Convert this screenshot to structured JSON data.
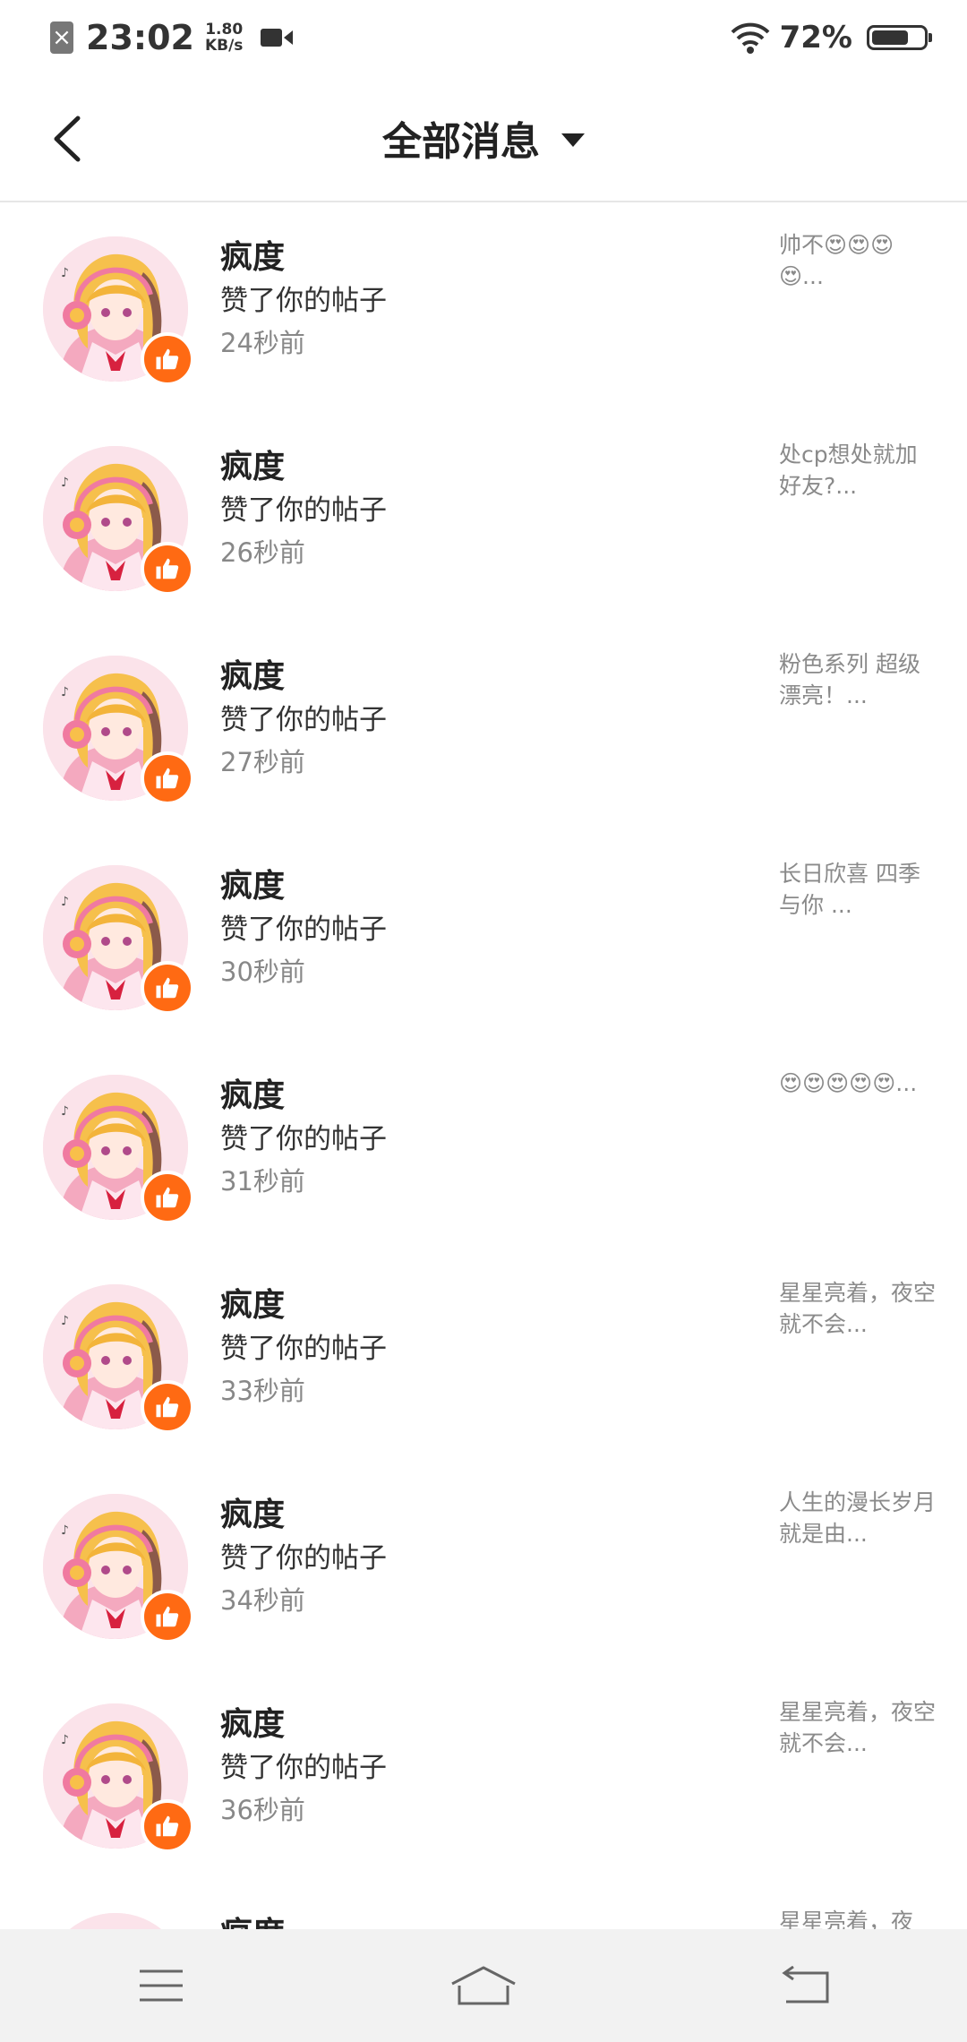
{
  "status_bar": {
    "time": "23:02",
    "speed_value": "1.80",
    "speed_unit": "KB/s",
    "battery": "72%",
    "icons": [
      "sim-disabled-icon",
      "video-record-icon",
      "wifi-icon",
      "battery-icon"
    ],
    "battery_level": 0.72
  },
  "header": {
    "title": "全部消息",
    "back_icon": "chevron-left-icon",
    "dropdown_icon": "caret-down-icon"
  },
  "messages": [
    {
      "name": "疯度",
      "action": "赞了你的帖子",
      "time": "24秒前",
      "preview": "帅不😍😍😍😍..."
    },
    {
      "name": "疯度",
      "action": "赞了你的帖子",
      "time": "26秒前",
      "preview": "处cp想处就加好友?..."
    },
    {
      "name": "疯度",
      "action": "赞了你的帖子",
      "time": "27秒前",
      "preview": "粉色系列 超级漂亮！..."
    },
    {
      "name": "疯度",
      "action": "赞了你的帖子",
      "time": "30秒前",
      "preview": "长日欣喜 四季与你 ..."
    },
    {
      "name": "疯度",
      "action": "赞了你的帖子",
      "time": "31秒前",
      "preview": "😍😍😍😍😍..."
    },
    {
      "name": "疯度",
      "action": "赞了你的帖子",
      "time": "33秒前",
      "preview": "星星亮着，夜空就不会..."
    },
    {
      "name": "疯度",
      "action": "赞了你的帖子",
      "time": "34秒前",
      "preview": "人生的漫长岁月就是由..."
    },
    {
      "name": "疯度",
      "action": "赞了你的帖子",
      "time": "36秒前",
      "preview": "星星亮着，夜空就不会..."
    },
    {
      "name": "疯度",
      "action": "",
      "time": "",
      "preview": "星星亮着，夜"
    }
  ],
  "nav_bar": {
    "icons": [
      "menu-icon",
      "home-icon",
      "back-icon"
    ]
  },
  "colors": {
    "accent": "#ff6a13",
    "nav_background": "#f2f2f2"
  }
}
